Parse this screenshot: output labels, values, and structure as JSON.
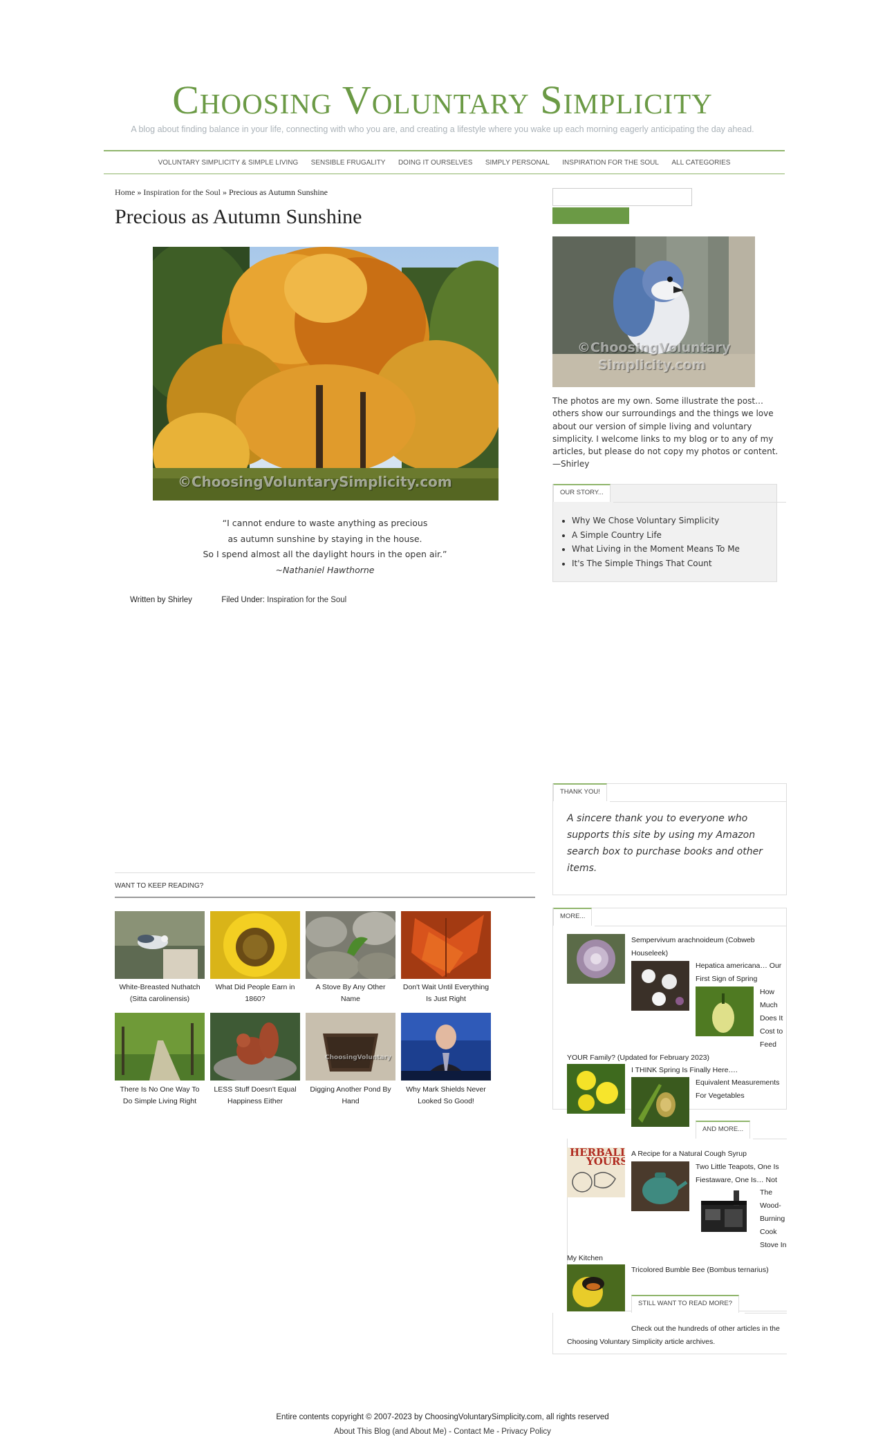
{
  "site": {
    "title": "Choosing Voluntary Simplicity",
    "description": "A blog about finding balance in your life, connecting with who you are, and creating a lifestyle where you wake up each morning eagerly anticipating the day ahead."
  },
  "nav": {
    "items": [
      {
        "label": "Voluntary Simplicity & Simple Living"
      },
      {
        "label": "Sensible Frugality"
      },
      {
        "label": "Doing It Ourselves"
      },
      {
        "label": "Simply Personal"
      },
      {
        "label": "Inspiration for the Soul"
      },
      {
        "label": "All Categories"
      }
    ]
  },
  "breadcrumb": {
    "home": "Home",
    "sep1": " » ",
    "category": "Inspiration for the Soul",
    "sep2": " » ",
    "current": "Precious as Autumn Sunshine"
  },
  "post": {
    "title": "Precious as Autumn Sunshine",
    "photo_watermark": "©ChoosingVoluntarySimplicity.com",
    "quote_lines": [
      "“I cannot endure to waste anything as precious",
      "as autumn sunshine by staying in the house.",
      "So I spend almost all the daylight hours in the open air.”"
    ],
    "quote_attribution": "~Nathaniel Hawthorne",
    "written_by": "Written by Shirley",
    "filed_under_label": "Filed Under: ",
    "filed_under_value": "Inspiration for the Soul"
  },
  "related": {
    "heading": "Want to keep reading?",
    "items": [
      {
        "title": "White-Breasted Nuthatch (Sitta carolinensis)"
      },
      {
        "title": "What Did People Earn in 1860?"
      },
      {
        "title": "A Stove By Any Other Name"
      },
      {
        "title": "Don't Wait Until Everything Is Just Right"
      },
      {
        "title": "There Is No One Way To Do Simple Living Right"
      },
      {
        "title": "LESS Stuff Doesn't Equal Happiness Either"
      },
      {
        "title": "Digging Another Pond By Hand"
      },
      {
        "title": "Why Mark Shields Never Looked So Good!"
      }
    ]
  },
  "sidebar": {
    "photo_watermark_line1": "©ChoosingVoluntary",
    "photo_watermark_line2": "Simplicity.com",
    "photo_note": "The photos are my own. Some illustrate the post… others show our surroundings and the things we love about our version of simple living and voluntary simplicity. I welcome links to my blog or to any of my articles, but please do not copy my photos or content. —Shirley",
    "our_story": {
      "tab": "Our Story...",
      "items": [
        {
          "label": "Why We Chose Voluntary Simplicity"
        },
        {
          "label": "A Simple Country Life"
        },
        {
          "label": "What Living in the Moment Means To Me"
        },
        {
          "label": "It's The Simple Things That Count"
        }
      ]
    },
    "thank_you": {
      "tab": "Thank You!",
      "text": "A sincere thank you to everyone who supports this site by using my Amazon search box to purchase books and other items."
    },
    "more": {
      "tab": "More...",
      "a_line1": "Sempervivum arachnoideum (Cobweb",
      "a_line2": "Houseleek)",
      "b_line1": "Hepatica americana… Our",
      "b_line2": "First Sign of Spring",
      "c_line1": "How",
      "c_line2": "Much",
      "c_line3": "Does It",
      "c_line4": "Cost to",
      "c_line5": "Feed",
      "c_line6": "YOUR Family? (Updated for February 2023)",
      "d_line1": "I THINK Spring Is Finally Here….",
      "e_line1": "Equivalent Measurements",
      "e_line2": "For Vegetables"
    },
    "and_more": {
      "tab": "And More...",
      "a_line1": "A Recipe for a Natural Cough Syrup",
      "logo_text1": "HERBALLY",
      "logo_text2": "YOURS",
      "b_line1": "Two Little Teapots, One Is",
      "b_line2": "Fiestaware, One Is… Not",
      "c_line1": "The",
      "c_line2": "Wood-",
      "c_line3": "Burning",
      "c_line4": "Cook",
      "c_line5": "Stove In",
      "c_line6": "My Kitchen",
      "d_line1": "Tricolored Bumble Bee (Bombus ternarius)"
    },
    "still_more": {
      "tab": "Still Want to Read More?",
      "line1": "Check out the hundreds of other articles in the",
      "line2": "Choosing Voluntary Simplicity article archives."
    }
  },
  "footer": {
    "copyright": "Entire contents copyright © 2007-2023 by ChoosingVoluntarySimplicity.com, all rights reserved",
    "about": "About This Blog (and About Me)",
    "sep1": " - ",
    "contact": "Contact Me",
    "sep2": " - ",
    "privacy": "Privacy Policy"
  },
  "colors": {
    "brand_green": "#6b9a45",
    "nav_border": "#8fb56b",
    "widget_bg": "#f1f1f1"
  }
}
